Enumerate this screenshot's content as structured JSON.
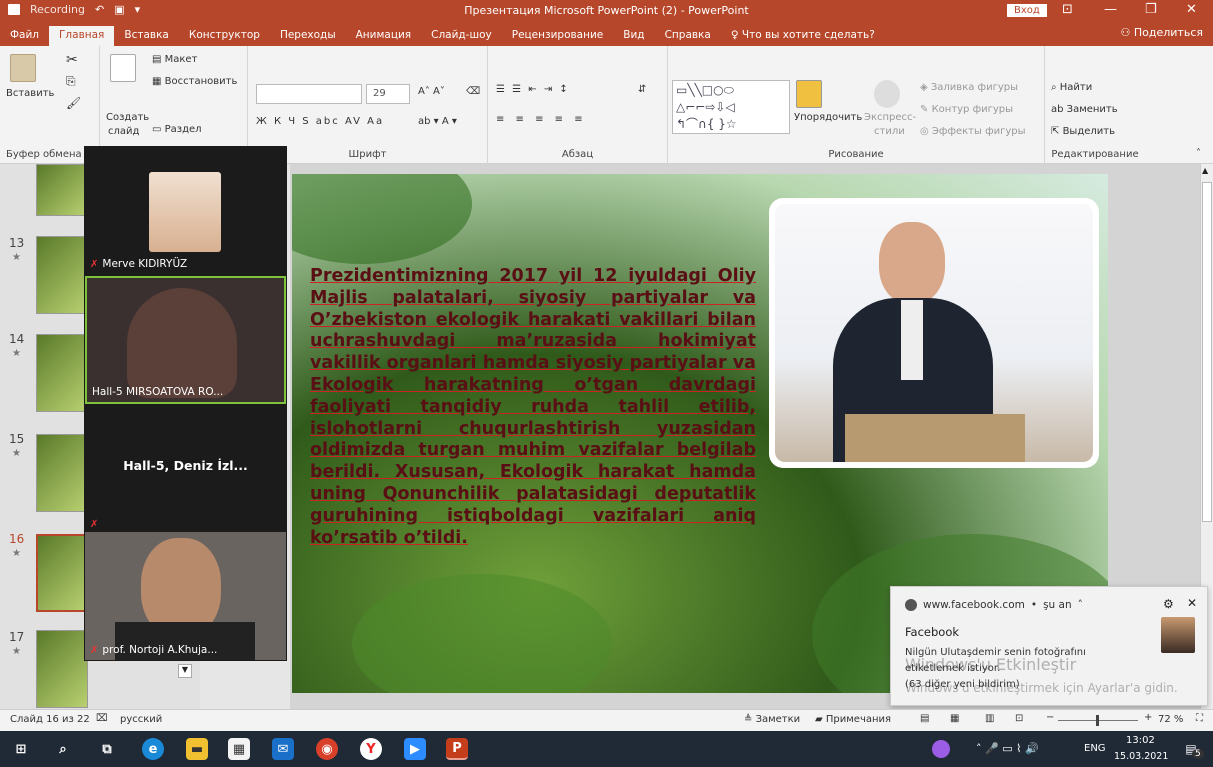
{
  "titlebar": {
    "recording": "Recording",
    "title": "Презентация Microsoft PowerPoint (2) - PowerPoint",
    "login": "Вход"
  },
  "tabs": [
    "Файл",
    "Главная",
    "Вставка",
    "Конструктор",
    "Переходы",
    "Анимация",
    "Слайд-шоу",
    "Рецензирование",
    "Вид",
    "Справка"
  ],
  "tellme": "Что вы хотите сделать?",
  "share": "Поделиться",
  "ribbon": {
    "paste": "Вставить",
    "new_slide_1": "Создать",
    "new_slide_2": "слайд",
    "layout": "Макет",
    "reset": "Восстановить",
    "section": "Раздел",
    "font_size": "29",
    "arrange": "Упорядочить",
    "express_1": "Экспресс-",
    "express_2": "стили",
    "shape_fill": "Заливка фигуры",
    "shape_outline": "Контур фигуры",
    "shape_effects": "Эффекты фигуры",
    "find": "Найти",
    "replace": "Заменить",
    "select": "Выделить",
    "groups": {
      "clipboard": "Буфер обмена",
      "font": "Шрифт",
      "paragraph": "Абзац",
      "drawing": "Рисование",
      "editing": "Редактирование"
    }
  },
  "thumbnails": [
    "13",
    "14",
    "15",
    "16",
    "17"
  ],
  "participants": [
    {
      "name": "Merve KIDIRYÜZ"
    },
    {
      "name": "Hall-5 MIRSOATOVA RO..."
    },
    {
      "name": "Hall-5,  Deniz İzl..."
    },
    {
      "name": "prof. Nortoji A.Khuja..."
    }
  ],
  "slide_text": "Prezidentimizning 2017 yil 12 iyuldagi Oliy Majlis palatalari, siyosiy partiyalar va O’zbekiston ekologik harakati vakillari bilan uchrashuvdagi ma’ruzasida hokimiyat vakillik organlari hamda siyosiy partiyalar va Ekologik harakatning o’tgan davrdagi faoliyati tanqidiy ruhda tahlil etilib, islohotlarni chuqurlashtirish yuzasidan oldimizda turgan muhim vazifalar belgilab berildi. Xususan, Ekologik harakat hamda uning Qonunchilik palatasidagi deputatlik guruhining istiqboldagi vazifalari aniq ko’rsatib o’tildi.",
  "notification": {
    "source": "www.facebook.com",
    "time": "şu an",
    "app": "Facebook",
    "message_1": "Nilgün Ulutaşdemir senin fotoğrafını",
    "message_2": "etiketlemek istiyor.",
    "message_3": "(63 diğer yeni bildirim)",
    "watermark_1": "Windows'u Etkinleştir",
    "watermark_2": "Windows'u etkinleştirmek için Ayarlar'a gidin."
  },
  "statusbar": {
    "slide_info": "Слайд 16 из 22",
    "language": "русский",
    "notes": "Заметки",
    "comments": "Примечания",
    "zoom": "72 %"
  },
  "taskbar": {
    "lang": "ENG",
    "time": "13:02",
    "date": "15.03.2021",
    "notif_count": "5"
  },
  "colors": {
    "accent": "#b7472a",
    "taskbar": "#1f2a36",
    "slide_text": "#5a0f14"
  }
}
